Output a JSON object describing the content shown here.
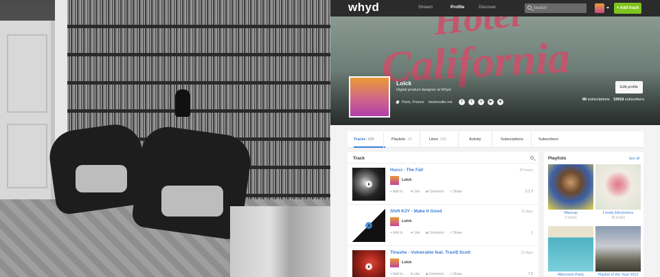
{
  "topbar": {
    "logo": "whyd",
    "nav": [
      {
        "label": "Stream",
        "active": false
      },
      {
        "label": "Profile",
        "active": true
      },
      {
        "label": "Discover",
        "active": false
      }
    ],
    "search_placeholder": "Search",
    "add_track_label": "+ Add track"
  },
  "profile": {
    "name": "Loïck",
    "bio": "Digital product designer at Whyd",
    "location": "Paris, France",
    "website": "loickmuller.me",
    "social_icons": [
      "facebook-icon",
      "twitter-icon",
      "soundcloud-icon",
      "youtube-icon",
      "lastfm-icon"
    ],
    "edit_label": "Edit profile",
    "subscriptions_count": "88",
    "subscriptions_label": "subscriptions",
    "subscribers_count": "19918",
    "subscribers_label": "subscribers"
  },
  "tabs": [
    {
      "label": "Tracks",
      "count": "429"
    },
    {
      "label": "Playlists",
      "count": "18"
    },
    {
      "label": "Likes",
      "count": "266"
    },
    {
      "label": "Activity",
      "count": ""
    },
    {
      "label": "Subscriptions",
      "count": ""
    },
    {
      "label": "Subscribers",
      "count": ""
    }
  ],
  "tracks_section": {
    "header": "Track",
    "items": [
      {
        "title": "Hucci - The Fall",
        "ago": "16 hours",
        "user": "Loïck",
        "add": "Add to",
        "like": "Like",
        "comment": "Comment",
        "share": "Share",
        "counts": "3  1  3"
      },
      {
        "title": "Shift K3Y - Make It Good",
        "ago": "11 days",
        "user": "Loïck",
        "add": "Add to",
        "like": "Like",
        "comment": "Comment",
        "share": "Share",
        "counts": "1"
      },
      {
        "title": "Tinashe - Vulnerable feat. Travi$ Scott",
        "ago": "12 days",
        "user": "Loïck",
        "add": "Add to",
        "like": "Like",
        "comment": "Comment",
        "share": "Share",
        "counts": "7  5"
      }
    ]
  },
  "playlists_section": {
    "header": "Playlists",
    "see_all": "See all",
    "items": [
      {
        "name": "Wassup",
        "count": "2 tracks"
      },
      {
        "name": "Lovely Electronics",
        "count": "18 tracks"
      },
      {
        "name": "Afternoon Party",
        "count": ""
      },
      {
        "name": "Playlist of the Year 2012",
        "count": ""
      }
    ]
  },
  "colors": {
    "accent": "#3b7dd8",
    "add_track": "#7ec31f",
    "topbar": "#2b2b2b"
  }
}
